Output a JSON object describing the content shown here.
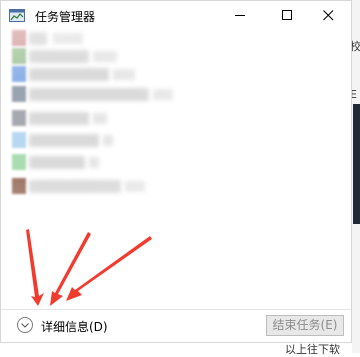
{
  "window": {
    "title": "任务管理器",
    "icon": "task-manager-icon"
  },
  "controls": {
    "minimize_icon": "minimize-icon",
    "maximize_icon": "maximize-icon",
    "close_icon": "close-icon"
  },
  "process_list": {
    "rows": [
      {
        "icon_color": "#d7a5a5"
      },
      {
        "icon_color": "#a8c8a0"
      },
      {
        "icon_color": "#8fb2e8"
      },
      {
        "icon_color": "#9aa3b0"
      },
      {
        "icon_color": "#a8a8b0"
      },
      {
        "icon_color": "#b7d8f0"
      },
      {
        "icon_color": "#a9dcb0"
      },
      {
        "icon_color": "#9a7060"
      }
    ]
  },
  "footer": {
    "expand_label": "详细信息(D)",
    "end_task_label": "结束任务(E)"
  },
  "annotation": {
    "arrow_color": "#f23b2f"
  },
  "background": {
    "bottom_text": "以上往下软"
  }
}
